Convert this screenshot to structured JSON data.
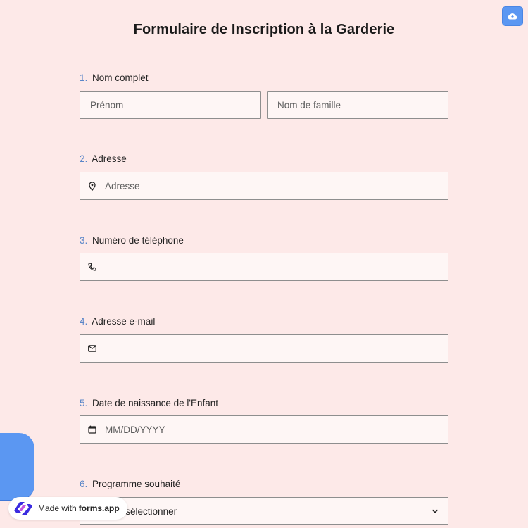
{
  "form": {
    "title": "Formulaire de Inscription à la Garderie",
    "questions": [
      {
        "number": "1.",
        "label": "Nom complet",
        "placeholders": [
          "Prénom",
          "Nom de famille"
        ]
      },
      {
        "number": "2.",
        "label": "Adresse",
        "placeholder": "Adresse",
        "icon": "location-pin-icon"
      },
      {
        "number": "3.",
        "label": "Numéro de téléphone",
        "placeholder": "",
        "icon": "phone-icon"
      },
      {
        "number": "4.",
        "label": "Adresse e-mail",
        "placeholder": "",
        "icon": "mail-icon"
      },
      {
        "number": "5.",
        "label": "Date de naissance de l'Enfant",
        "placeholder": "MM/DD/YYYY",
        "icon": "calendar-icon"
      },
      {
        "number": "6.",
        "label": "Programme souhaité",
        "selected": "Veuillez sélectionner",
        "icon": "chevron-down-icon"
      }
    ]
  },
  "toolbar": {
    "upload_icon": "cloud-upload-icon"
  },
  "badge": {
    "prefix": "Made with",
    "brand": "forms.app"
  },
  "colors": {
    "background": "#fde9e8",
    "accent": "#5b97f2",
    "field_bg": "#fef6f5",
    "number": "#5a86c8"
  }
}
